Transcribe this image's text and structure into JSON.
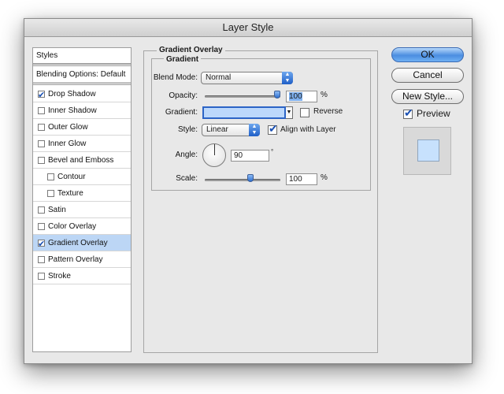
{
  "window": {
    "title": "Layer Style"
  },
  "styles_list": {
    "header": "Styles",
    "blending": "Blending Options: Default",
    "items": [
      {
        "label": "Drop Shadow",
        "checked": true,
        "selected": false,
        "indent": false
      },
      {
        "label": "Inner Shadow",
        "checked": false,
        "selected": false,
        "indent": false
      },
      {
        "label": "Outer Glow",
        "checked": false,
        "selected": false,
        "indent": false
      },
      {
        "label": "Inner Glow",
        "checked": false,
        "selected": false,
        "indent": false
      },
      {
        "label": "Bevel and Emboss",
        "checked": false,
        "selected": false,
        "indent": false
      },
      {
        "label": "Contour",
        "checked": false,
        "selected": false,
        "indent": true
      },
      {
        "label": "Texture",
        "checked": false,
        "selected": false,
        "indent": true
      },
      {
        "label": "Satin",
        "checked": false,
        "selected": false,
        "indent": false
      },
      {
        "label": "Color Overlay",
        "checked": false,
        "selected": false,
        "indent": false
      },
      {
        "label": "Gradient Overlay",
        "checked": true,
        "selected": true,
        "indent": false
      },
      {
        "label": "Pattern Overlay",
        "checked": false,
        "selected": false,
        "indent": false
      },
      {
        "label": "Stroke",
        "checked": false,
        "selected": false,
        "indent": false
      }
    ]
  },
  "gradient_overlay": {
    "section_title": "Gradient Overlay",
    "group_title": "Gradient",
    "blend_mode_label": "Blend Mode:",
    "blend_mode_value": "Normal",
    "opacity_label": "Opacity:",
    "opacity_value": "100",
    "opacity_unit": "%",
    "opacity_fraction": 1.0,
    "gradient_label": "Gradient:",
    "gradient_color": "#bcd8fb",
    "reverse_label": "Reverse",
    "reverse_checked": false,
    "style_label": "Style:",
    "style_value": "Linear",
    "align_label": "Align with Layer",
    "align_checked": true,
    "angle_label": "Angle:",
    "angle_value": "90",
    "angle_unit": "°",
    "scale_label": "Scale:",
    "scale_value": "100",
    "scale_unit": "%",
    "scale_fraction": 0.6
  },
  "buttons": {
    "ok": "OK",
    "cancel": "Cancel",
    "new_style": "New Style...",
    "preview_label": "Preview",
    "preview_checked": true
  },
  "colors": {
    "accent": "#3a7fe0",
    "selection": "#bcd6f5",
    "preview_swatch": "#c7e1fd"
  }
}
